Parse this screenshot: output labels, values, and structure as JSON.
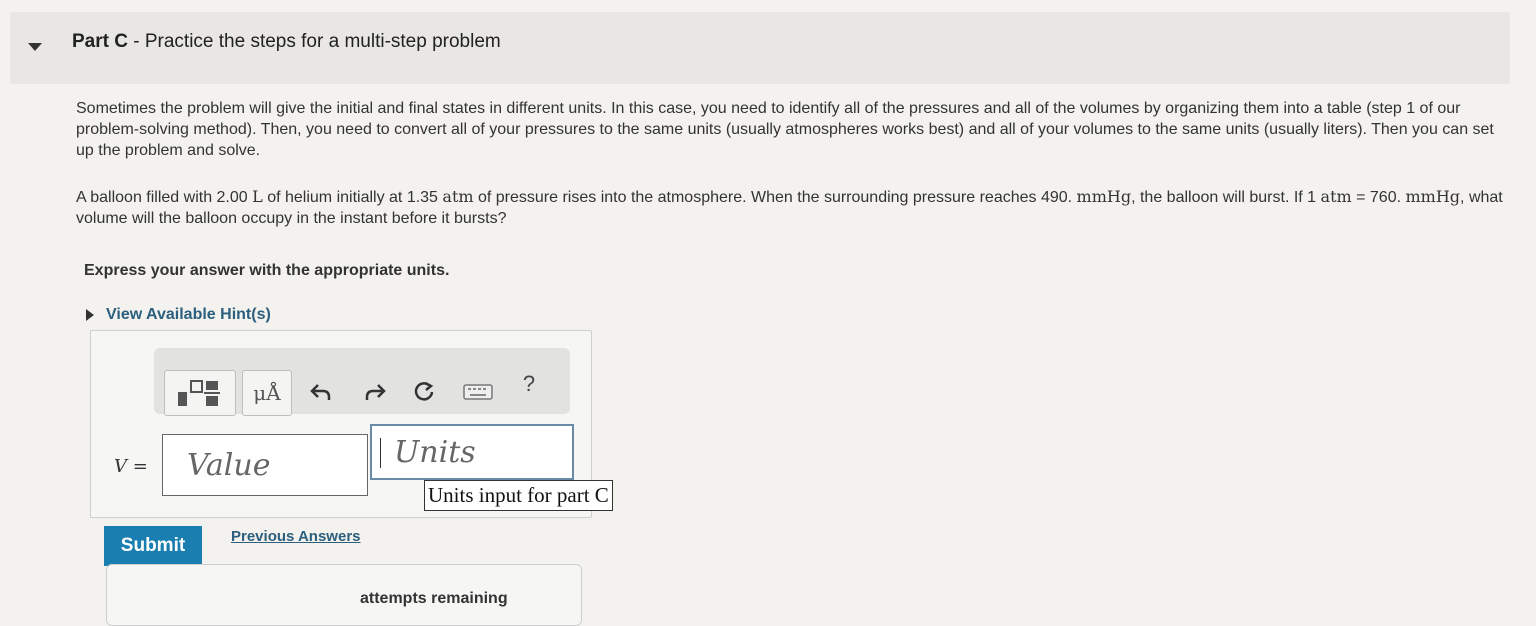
{
  "part": {
    "label": "Part C",
    "title": "- Practice the steps for a multi-step problem"
  },
  "intro": {
    "text": "Sometimes the problem will give the initial and final states in different units. In this case, you need to identify all of the pressures and all of the volumes by organizing them into a table (step 1 of our problem-solving method). Then, you need to convert all of your pressures to the same units (usually atmospheres works best) and all of your volumes to the same units (usually liters). Then you can set up the problem and solve."
  },
  "question": {
    "t1": "A balloon filled with 2.00 ",
    "u_L": "L",
    "t2": " of helium initially at 1.35 ",
    "u_atm1": "atm",
    "t3": " of pressure rises into the atmosphere. When the surrounding pressure reaches 490. ",
    "u_mmHg1": "mmHg",
    "t4": ", the balloon will burst. If 1 ",
    "u_atm2": "atm",
    "t5": " = 760. ",
    "u_mmHg2": "mmHg",
    "t6": ", what volume will the balloon occupy in the instant before it bursts?"
  },
  "instruction": "Express your answer with the appropriate units.",
  "hint": {
    "label": "View Available Hint(s)"
  },
  "toolbar": {
    "units_symbol": "μÅ",
    "help_symbol": "?"
  },
  "answer": {
    "variable": "V",
    "equals": " =",
    "value_placeholder": "Value",
    "units_placeholder": "Units",
    "tooltip": "Units input for part C"
  },
  "submit_label": "Submit",
  "previous_answers_label": "Previous Answers",
  "feedback_text": "attempts remaining"
}
